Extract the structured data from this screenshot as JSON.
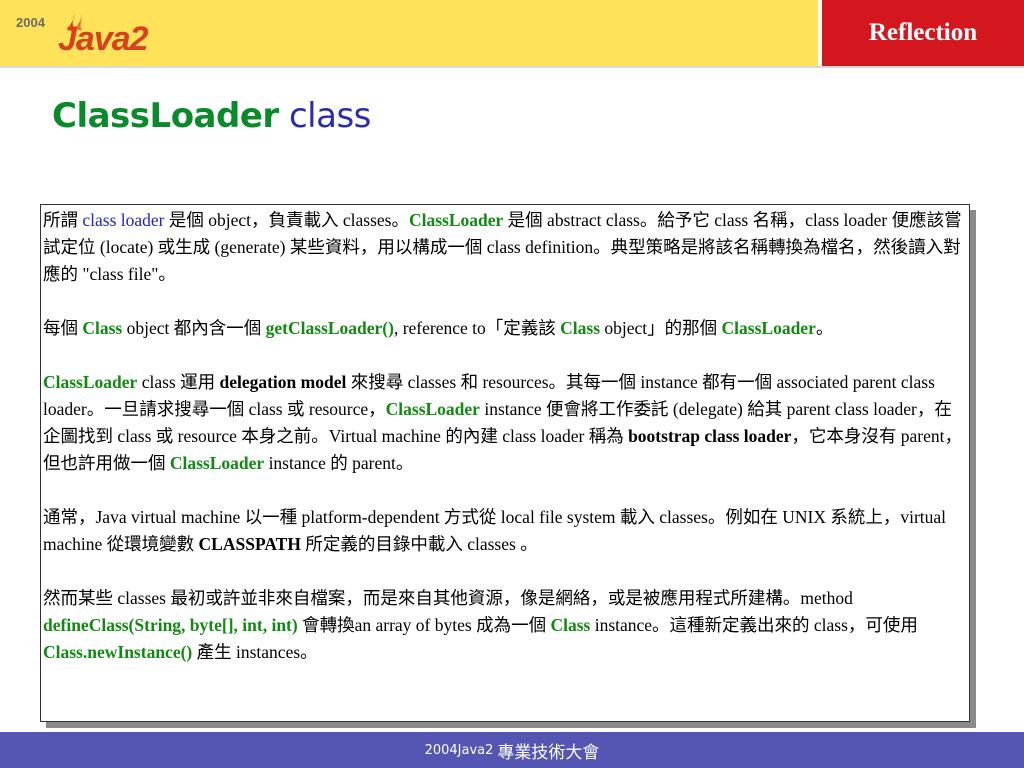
{
  "header": {
    "logo": {
      "year": "2004",
      "word": "Java2"
    },
    "badge": "Reflection"
  },
  "title": {
    "main": "ClassLoader",
    "sub": "class"
  },
  "paragraphs": [
    [
      {
        "t": "所謂 ",
        "s": "n"
      },
      {
        "t": "class loader",
        "s": "blue"
      },
      {
        "t": " 是個 object，負責載入 classes。",
        "s": "n"
      },
      {
        "t": "ClassLoader",
        "s": "green"
      },
      {
        "t": " 是個 abstract class。給予它 class 名稱，class loader 便應該嘗試定位 (locate) 或生成 (generate) 某些資料，用以構成一個 class definition。典型策略是將該名稱轉換為檔名，然後讀入對應的 \"class file\"。",
        "s": "n"
      }
    ],
    [
      {
        "t": "每個 ",
        "s": "n"
      },
      {
        "t": "Class",
        "s": "green"
      },
      {
        "t": " object 都內含一個 ",
        "s": "n"
      },
      {
        "t": "getClassLoader()",
        "s": "green"
      },
      {
        "t": ", reference to「定義該 ",
        "s": "n"
      },
      {
        "t": "Class",
        "s": "green"
      },
      {
        "t": " object」的那個 ",
        "s": "n"
      },
      {
        "t": "ClassLoader",
        "s": "green"
      },
      {
        "t": "。",
        "s": "n"
      }
    ],
    [
      {
        "t": "ClassLoader",
        "s": "green"
      },
      {
        "t": " class 運用 ",
        "s": "n"
      },
      {
        "t": "delegation model",
        "s": "bold"
      },
      {
        "t": " 來搜尋 classes 和 resources。其每一個 instance 都有一個 associated parent class loader。一旦請求搜尋一個 class 或 resource，",
        "s": "n"
      },
      {
        "t": "ClassLoader",
        "s": "green"
      },
      {
        "t": " instance 便會將工作委託 (delegate) 給其 parent class loader，在企圖找到 class 或 resource 本身之前。Virtual machine 的內建 class loader 稱為 ",
        "s": "n"
      },
      {
        "t": "bootstrap class loader",
        "s": "bold"
      },
      {
        "t": "，它本身沒有 parent，但也許用做一個 ",
        "s": "n"
      },
      {
        "t": "ClassLoader",
        "s": "green"
      },
      {
        "t": " instance 的 parent。",
        "s": "n"
      }
    ],
    [
      {
        "t": "通常，Java virtual machine 以一種 platform-dependent 方式從 local file system 載入 classes。例如在 UNIX 系統上，virtual machine 從環境變數 ",
        "s": "n"
      },
      {
        "t": "CLASSPATH",
        "s": "bold"
      },
      {
        "t": " 所定義的目錄中載入 classes 。",
        "s": "n"
      }
    ],
    [
      {
        "t": "然而某些 classes 最初或許並非來自檔案，而是來自其他資源，像是網絡，或是被應用程式所建構。method ",
        "s": "n"
      },
      {
        "t": "defineClass(String, byte[], int, int)",
        "s": "green"
      },
      {
        "t": " 會轉換an array of bytes 成為一個 ",
        "s": "n"
      },
      {
        "t": "Class",
        "s": "green"
      },
      {
        "t": " instance。這種新定義出來的 class，可使用 ",
        "s": "n"
      },
      {
        "t": "Class.newInstance()",
        "s": "green"
      },
      {
        "t": " 產生 instances。",
        "s": "n"
      }
    ]
  ],
  "footer": {
    "prefix": "2004 ",
    "product": "Java2",
    "event": "專業技術大會"
  },
  "colors": {
    "header_bg": "#fde25a",
    "badge_bg": "#d4171e",
    "title_main": "#0a8a2a",
    "title_sub": "#2b2bb0",
    "keyword_green": "#118a11",
    "keyword_blue": "#2222cc",
    "footer_bg": "#5555b3"
  }
}
